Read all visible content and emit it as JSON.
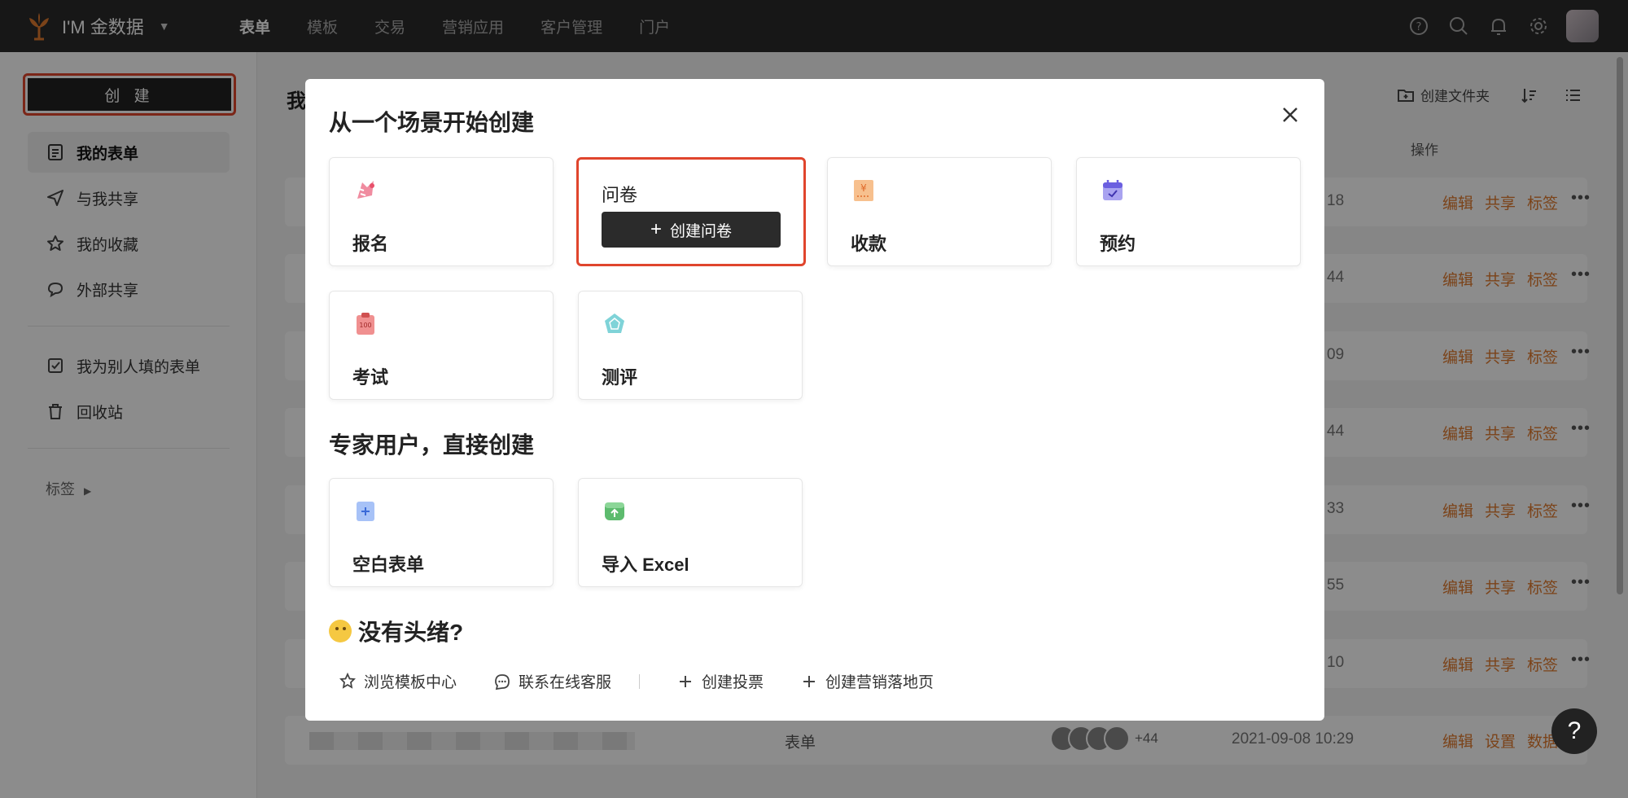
{
  "brand": {
    "name": "I'M 金数据",
    "accent": "#e07a2f"
  },
  "nav": [
    {
      "label": "表单",
      "active": true
    },
    {
      "label": "模板"
    },
    {
      "label": "交易"
    },
    {
      "label": "营销应用"
    },
    {
      "label": "客户管理"
    },
    {
      "label": "门户"
    }
  ],
  "sidebar": {
    "create_label": "创 建",
    "items": [
      {
        "label": "我的表单",
        "icon": "form-icon",
        "active": true
      },
      {
        "label": "与我共享",
        "icon": "send-icon"
      },
      {
        "label": "我的收藏",
        "icon": "star-icon"
      },
      {
        "label": "外部共享",
        "icon": "chat-share-icon"
      },
      {
        "label": "我为别人填的表单",
        "icon": "checkbox-icon"
      },
      {
        "label": "回收站",
        "icon": "trash-icon"
      }
    ],
    "tags_label": "标签"
  },
  "main": {
    "title_partial": "我",
    "create_folder_label": "创建文件夹",
    "ops_header": "操作",
    "rows": [
      {
        "time": "18",
        "ops": [
          "编辑",
          "共享",
          "标签"
        ]
      },
      {
        "time": "44",
        "ops": [
          "编辑",
          "共享",
          "标签"
        ]
      },
      {
        "time": "09",
        "ops": [
          "编辑",
          "共享",
          "标签"
        ]
      },
      {
        "time": "44",
        "ops": [
          "编辑",
          "共享",
          "标签"
        ]
      },
      {
        "time": "33",
        "ops": [
          "编辑",
          "共享",
          "标签"
        ]
      },
      {
        "time": "55",
        "ops": [
          "编辑",
          "共享",
          "标签"
        ]
      },
      {
        "time": "10",
        "ops": [
          "编辑",
          "共享",
          "标签"
        ]
      }
    ],
    "last_row": {
      "type": "表单",
      "count": "+44",
      "time": "2021-09-08 10:29",
      "ops": [
        "编辑",
        "设置",
        "数据"
      ]
    }
  },
  "modal": {
    "title": "从一个场景开始创建",
    "scenes": [
      {
        "label": "报名",
        "icon": "signup-icon"
      },
      {
        "label": "问卷",
        "icon": "survey-icon",
        "cta": "创建问卷"
      },
      {
        "label": "收款",
        "icon": "payment-icon"
      },
      {
        "label": "预约",
        "icon": "calendar-icon"
      },
      {
        "label": "考试",
        "icon": "exam-icon"
      },
      {
        "label": "测评",
        "icon": "assessment-icon"
      }
    ],
    "expert_title": "专家用户，直接创建",
    "expert": [
      {
        "label": "空白表单",
        "icon": "blank-form-icon"
      },
      {
        "label": "导入 Excel",
        "icon": "import-excel-icon"
      }
    ],
    "idea_title": "没有头绪?",
    "links": [
      {
        "label": "浏览模板中心",
        "icon": "template-icon"
      },
      {
        "label": "联系在线客服",
        "icon": "chat-icon"
      },
      {
        "label": "创建投票",
        "icon": "plus-icon"
      },
      {
        "label": "创建营销落地页",
        "icon": "plus-icon"
      }
    ]
  },
  "help_label": "?"
}
